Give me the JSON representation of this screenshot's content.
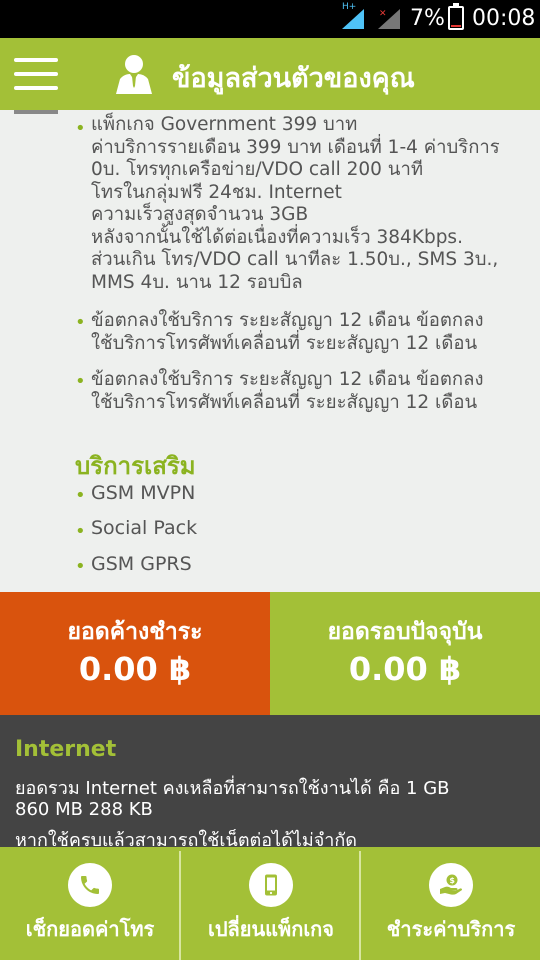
{
  "status_bar": {
    "network_type": "H+",
    "battery_percent": "7%",
    "time": "00:08"
  },
  "header": {
    "title": "ข้อมูลส่วนตัวของคุณ",
    "menu_icon": "hamburger-icon",
    "profile_icon": "user-icon"
  },
  "packages": [
    {
      "lines": [
        "แพ็กเกจ Government 399 บาท",
        "ค่าบริการรายเดือน 399 บาท เดือนที่ 1-4 ค่าบริการ",
        "0บ. โทรทุกเครือข่าย/VDO call 200 นาที",
        "โทรในกลุ่มฟรี 24ชม. Internet",
        "ความเร็วสูงสุดจำนวน 3GB",
        "หลังจากนั้นใช้ได้ต่อเนื่องที่ความเร็ว 384Kbps.",
        "ส่วนเกิน โทร/VDO call นาทีละ 1.50บ., SMS 3บ.,",
        "MMS 4บ. นาน 12 รอบบิล"
      ]
    },
    {
      "lines": [
        "ข้อตกลงใช้บริการ ระยะสัญญา 12 เดือน ข้อตกลง",
        "ใช้บริการโทรศัพท์เคลื่อนที่ ระยะสัญญา 12 เดือน"
      ]
    },
    {
      "lines": [
        "ข้อตกลงใช้บริการ ระยะสัญญา 12 เดือน ข้อตกลง",
        "ใช้บริการโทรศัพท์เคลื่อนที่ ระยะสัญญา 12 เดือน"
      ]
    }
  ],
  "extra_services": {
    "title": "บริการเสริม",
    "items": [
      "GSM MVPN",
      "Social Pack",
      "GSM GPRS"
    ]
  },
  "balances": {
    "outstanding_label": "ยอดค้างชำระ",
    "outstanding_value": "0.00 ฿",
    "current_label": "ยอดรอบปัจจุบัน",
    "current_value": "0.00 ฿"
  },
  "internet": {
    "title": "Internet",
    "line1": "ยอดรวม Internet คงเหลือที่สามารถใช้งานได้ คือ 1 GB",
    "line2": "860 MB 288 KB",
    "line3": "หากใช้ครบแล้วสามารถใช้เน็ตต่อได้ไม่จำกัด"
  },
  "bottom_nav": [
    {
      "label": "เช็กยอดค่าโทร",
      "icon": "phone-icon"
    },
    {
      "label": "เปลี่ยนแพ็กเกจ",
      "icon": "mobile-phone-icon"
    },
    {
      "label": "ชำระค่าบริการ",
      "icon": "payment-hand-icon"
    }
  ],
  "colors": {
    "brand_green": "#a3c037",
    "accent_orange": "#d9530d",
    "internet_panel": "#444444"
  }
}
